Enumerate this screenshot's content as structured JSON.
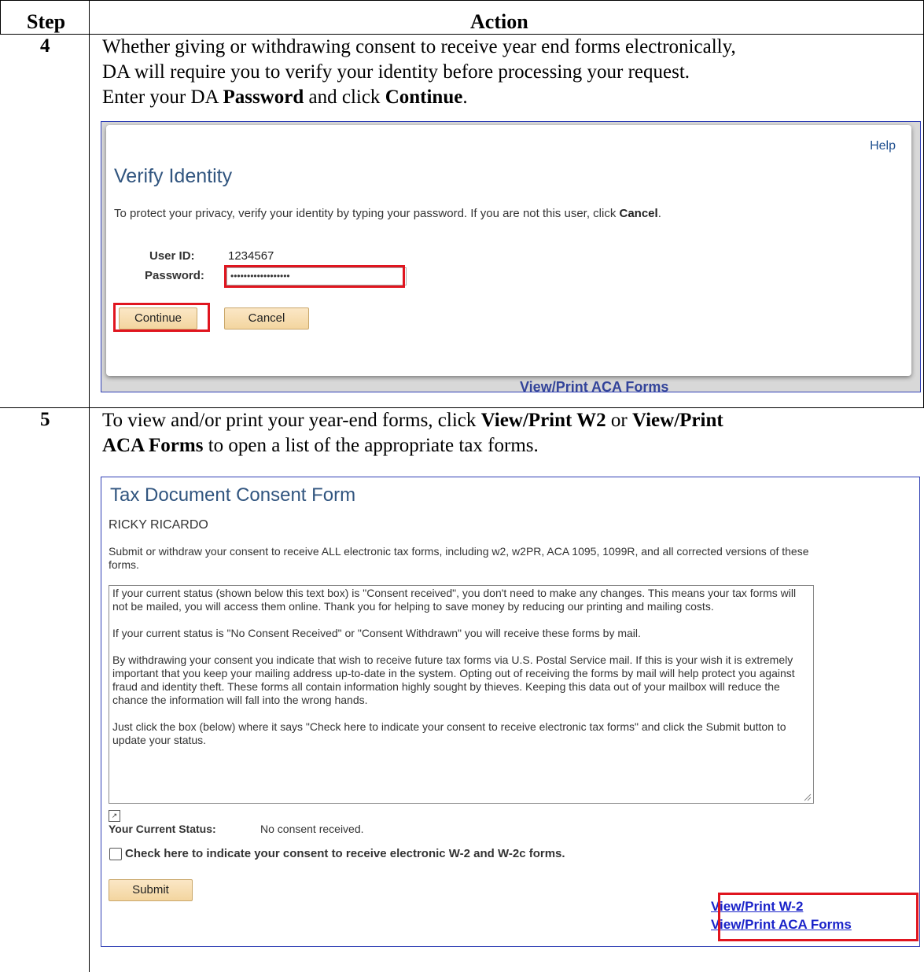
{
  "table": {
    "headers": {
      "step": "Step",
      "action": "Action"
    }
  },
  "rows": [
    {
      "step": "4",
      "text_line1": "Whether giving or withdrawing consent to receive year end forms electronically,",
      "text_line2": "DA will require you to verify your identity before processing your request.",
      "text_line3_pre": "Enter your DA ",
      "text_line3_b1": "Password",
      "text_line3_mid": " and click ",
      "text_line3_b2": "Continue",
      "text_line3_post": "."
    },
    {
      "step": "5",
      "text_line1_pre": "To view and/or print your year-end forms, click ",
      "text_line1_b1": "View/Print W2",
      "text_line1_mid": " or ",
      "text_line1_b2": "View/Print",
      "text_line2_b": "ACA Forms",
      "text_line2_post": " to open a list of the appropriate tax forms."
    }
  ],
  "verify_dialog": {
    "help": "Help",
    "title": "Verify Identity",
    "message_pre": "To protect your privacy, verify your identity by typing your password. If you are not this user, click ",
    "message_bold": "Cancel",
    "message_post": ".",
    "user_id_label": "User ID:",
    "user_id_value": "1234567",
    "password_label": "Password:",
    "password_value": "••••••••••••••••••",
    "continue_label": "Continue",
    "cancel_label": "Cancel",
    "background_link": "View/Print ACA Forms"
  },
  "consent_form": {
    "title": "Tax Document Consent Form",
    "name": "RICKY RICARDO",
    "intro": "Submit or withdraw your consent to receive ALL electronic tax forms, including w2, w2PR, ACA 1095, 1099R, and all corrected versions of these forms.",
    "paragraphs": [
      "If your current status (shown below this text box) is \"Consent received\", you don't need to make any changes. This means your tax forms will not be mailed, you will access them online. Thank you for helping to save money by reducing our printing and mailing costs.",
      "If your current status is \"No Consent Received\" or  \"Consent Withdrawn\" you will  receive these forms by mail.",
      "By withdrawing your consent you indicate that wish to receive future tax forms via U.S. Postal Service mail. If this is your wish it is extremely important that you keep your mailing address up-to-date in the system. Opting out of receiving the forms by mail will help protect you against fraud and identity theft. These forms all contain information highly sought by thieves. Keeping this data out of your mailbox will reduce the chance the information will fall into the wrong hands.",
      "Just click the box (below) where it says \"Check here to indicate your consent to receive electronic tax forms\" and click the Submit button to update your status."
    ],
    "current_status_label": "Your Current Status:",
    "current_status_value": "No consent received.",
    "checkbox_label": "Check here to indicate your consent to receive electronic W-2 and W-2c forms.",
    "submit_label": "Submit",
    "link_w2": "View/Print W-2",
    "link_aca": "View/Print ACA Forms"
  }
}
